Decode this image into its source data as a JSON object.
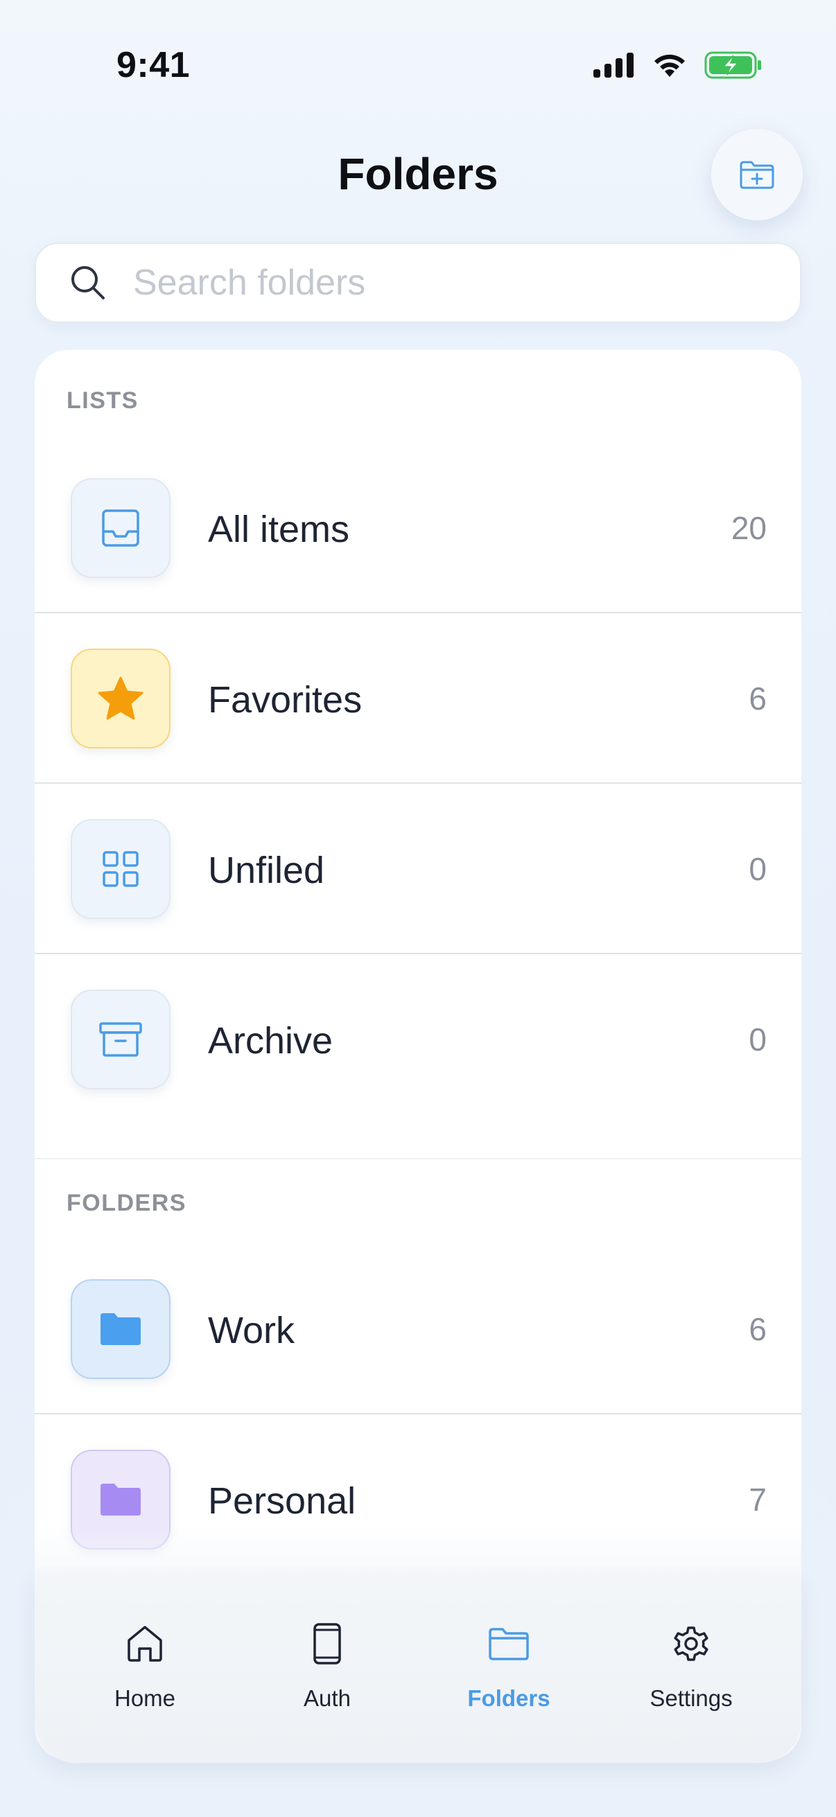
{
  "status_bar": {
    "time": "9:41"
  },
  "header": {
    "title": "Folders"
  },
  "search": {
    "placeholder": "Search folders",
    "value": ""
  },
  "sections": {
    "lists_label": "LISTS",
    "folders_label": "FOLDERS"
  },
  "lists": [
    {
      "label": "All items",
      "count": "20",
      "icon": "inbox-icon"
    },
    {
      "label": "Favorites",
      "count": "6",
      "icon": "star-icon"
    },
    {
      "label": "Unfiled",
      "count": "0",
      "icon": "grid-icon"
    },
    {
      "label": "Archive",
      "count": "0",
      "icon": "archive-icon"
    }
  ],
  "folders": [
    {
      "label": "Work",
      "count": "6",
      "icon": "folder-icon",
      "color": "#4a9fee"
    },
    {
      "label": "Personal",
      "count": "7",
      "icon": "folder-icon",
      "color": "#a68cf2"
    }
  ],
  "tabs": [
    {
      "label": "Home",
      "icon": "home-icon",
      "active": false
    },
    {
      "label": "Auth",
      "icon": "phone-icon",
      "active": false
    },
    {
      "label": "Folders",
      "icon": "folder-icon",
      "active": true
    },
    {
      "label": "Settings",
      "icon": "gear-icon",
      "active": false
    }
  ],
  "colors": {
    "accent": "#4a9be4",
    "battery": "#3fc15a",
    "star": "#f59e0b"
  }
}
